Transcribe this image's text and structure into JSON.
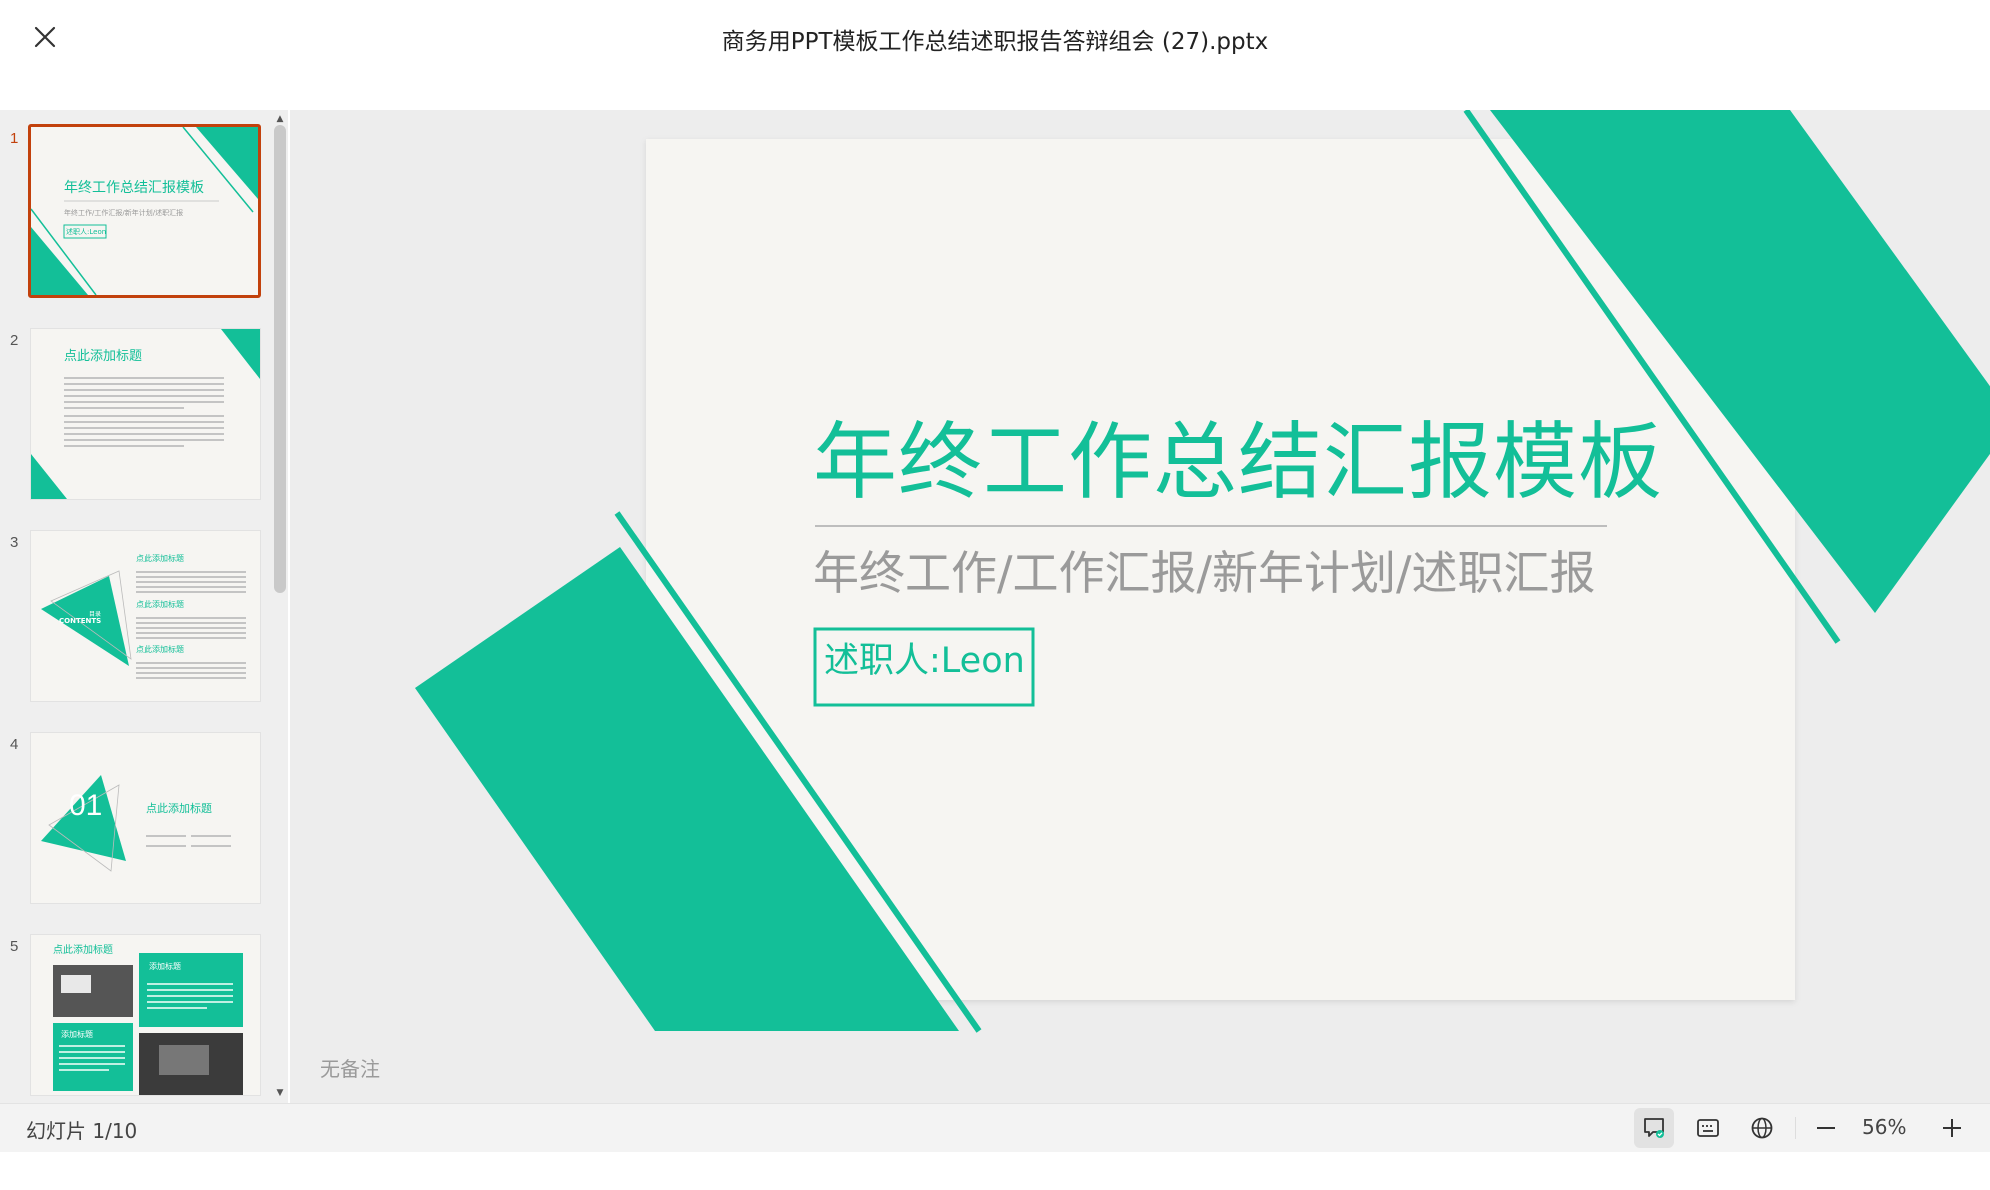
{
  "window": {
    "title": "商务用PPT模板工作总结述职报告答辩组会 (27).pptx"
  },
  "slide": {
    "title": "年终工作总结汇报模板",
    "subtitle": "年终工作/工作汇报/新年计划/述职汇报",
    "presenter": "述职人:Leon"
  },
  "thumbnails": [
    {
      "num": "1",
      "title": "年终工作总结汇报模板",
      "subtitle": "年终工作/工作汇报/新年计划/述职汇报",
      "presenter": "述职人:Leon"
    },
    {
      "num": "2",
      "title": "点此添加标题"
    },
    {
      "num": "3",
      "heading_a": "点此添加标题",
      "heading_b": "点此添加标题",
      "heading_c": "点此添加标题",
      "center_a": "目录",
      "center_b": "CONTENTS"
    },
    {
      "num": "4",
      "number": "01",
      "title": "点此添加标题"
    },
    {
      "num": "5",
      "title": "点此添加标题",
      "box_a": "添加标题",
      "box_b": "添加标题"
    }
  ],
  "notes": {
    "placeholder": "无备注"
  },
  "statusbar": {
    "slide_counter": "幻灯片 1/10",
    "zoom": "56%",
    "icons": [
      "notes-view-icon",
      "subtitles-icon",
      "globe-icon",
      "zoom-out-icon",
      "zoom-in-icon"
    ]
  },
  "colors": {
    "accent": "#13BF98",
    "active_border": "#C2410C",
    "slide_bg": "#F6F5F2"
  }
}
